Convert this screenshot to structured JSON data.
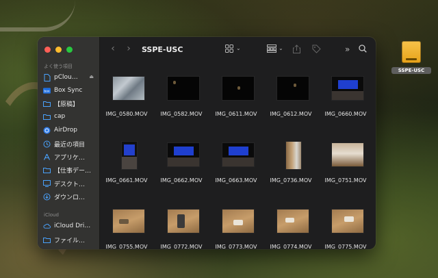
{
  "window": {
    "title": "SSPE-USC"
  },
  "sidebar": {
    "favorites_header": "よく使う項目",
    "icloud_header": "iCloud",
    "items": [
      {
        "label": "pClou…",
        "icon": "document-icon",
        "eject": "⏏"
      },
      {
        "label": "Box Sync",
        "icon": "box-icon"
      },
      {
        "label": "【原稿】",
        "icon": "folder-icon"
      },
      {
        "label": "cap",
        "icon": "folder-icon"
      },
      {
        "label": "AirDrop",
        "icon": "airdrop-icon"
      },
      {
        "label": "最近の項目",
        "icon": "clock-icon"
      },
      {
        "label": "アプリケ…",
        "icon": "applications-icon"
      },
      {
        "label": "【仕事デー…",
        "icon": "folder-icon"
      },
      {
        "label": "デスクト…",
        "icon": "desktop-icon"
      },
      {
        "label": "ダウンロ…",
        "icon": "download-icon"
      }
    ],
    "icloud_items": [
      {
        "label": "iCloud Dri…",
        "icon": "icloud-icon"
      },
      {
        "label": "ファイル…",
        "icon": "folder-icon"
      }
    ]
  },
  "files": [
    "IMG_0580.MOV",
    "IMG_0582.MOV",
    "IMG_0611.MOV",
    "IMG_0612.MOV",
    "IMG_0660.MOV",
    "IMG_0661.MOV",
    "IMG_0662.MOV",
    "IMG_0663.MOV",
    "IMG_0736.MOV",
    "IMG_0751.MOV",
    "IMG_0755.MOV",
    "IMG_0772.MOV",
    "IMG_0773.MOV",
    "IMG_0774.MOV",
    "IMG_0775.MOV"
  ],
  "desktop": {
    "drive_label": "SSPE-USC"
  },
  "colors": {
    "accent": "#0a84ff",
    "drive": "#f2b230"
  }
}
